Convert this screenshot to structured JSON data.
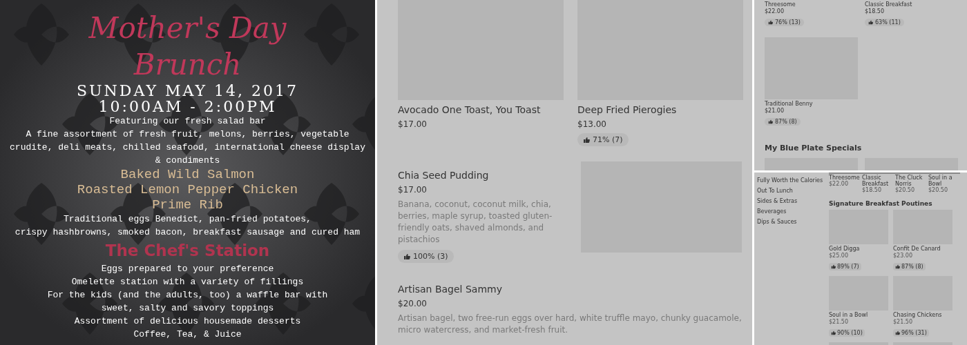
{
  "flyer": {
    "blocks": [
      {
        "kind": "script",
        "text": "Mother's Day"
      },
      {
        "kind": "script",
        "text": "Brunch"
      },
      {
        "kind": "caps",
        "text": "SUNDAY MAY 14, 2017"
      },
      {
        "kind": "caps",
        "text": "10:00AM - 2:00PM"
      },
      {
        "kind": "body",
        "text": "Featuring our fresh salad bar"
      },
      {
        "kind": "body",
        "text": "A fine assortment of fresh fruit, melons, berries, vegetable"
      },
      {
        "kind": "body",
        "text": "crudite, deli meats, chilled seafood, international cheese display"
      },
      {
        "kind": "body",
        "text": "& condiments"
      },
      {
        "kind": "entree",
        "text": "Baked Wild Salmon"
      },
      {
        "kind": "entree",
        "text": "Roasted Lemon Pepper Chicken"
      },
      {
        "kind": "entree",
        "text": "Prime Rib"
      },
      {
        "kind": "body",
        "text": "Traditional eggs Benedict, pan-fried potatoes,"
      },
      {
        "kind": "body",
        "text": "crispy hashbrowns, smoked bacon, breakfast sausage and cured ham"
      },
      {
        "kind": "station",
        "text": "The Chef's Station"
      },
      {
        "kind": "body",
        "text": "Eggs prepared to your preference"
      },
      {
        "kind": "body",
        "text": "Omelette station with a variety of fillings"
      },
      {
        "kind": "body",
        "text": "For the kids (and the adults, too) a waffle bar with"
      },
      {
        "kind": "body",
        "text": "sweet, salty and savory toppings"
      },
      {
        "kind": "body",
        "text": "Assortment of delicious housemade desserts"
      },
      {
        "kind": "body",
        "text": "Coffee, Tea, & Juice"
      }
    ]
  },
  "menu": {
    "items": [
      {
        "kind": "card",
        "name": "Avocado One Toast, You Toast",
        "price": "$17.00"
      },
      {
        "kind": "card",
        "name": "Deep Fried Pierogies",
        "price": "$13.00",
        "rating": "71% (7)"
      },
      {
        "kind": "row",
        "name": "Chia Seed Pudding",
        "price": "$17.00",
        "description": "Banana, coconut, coconut milk, chia, berries, maple syrup, toasted gluten-friendly oats, shaved almonds, and pistachios",
        "rating": "100% (3)"
      },
      {
        "kind": "text",
        "name": "Artisan Bagel Sammy",
        "price": "$20.00",
        "description": "Artisan bagel, two free-run eggs over hard, white truffle mayo, chunky guacamole, micro watercress, and market-fresh fruit."
      }
    ]
  },
  "small_menu": {
    "top_items": [
      {
        "name": "Threesome",
        "price": "$22.00",
        "rating": "76% (13)"
      },
      {
        "name": "Classic Breakfast",
        "price": "$18.50",
        "rating": "63% (11)"
      }
    ],
    "cards": [
      {
        "name": "Traditional Benny",
        "price": "$21.00",
        "rating": "87% (8)"
      }
    ],
    "heading": "My Blue Plate Specials"
  },
  "mini_menu": {
    "sidebar": [
      "Fully Worth the Calories",
      "Out To Lunch",
      "Sides & Extras",
      "Beverages",
      "Dips & Sauces"
    ],
    "strip": [
      {
        "name": "Threesome",
        "price": "$22.00"
      },
      {
        "name": "Classic Breakfast",
        "price": "$18.50"
      },
      {
        "name": "The Cluck Norris",
        "price": "$20.50"
      },
      {
        "name": "Soul in a Bowl",
        "price": "$20.50"
      }
    ],
    "heading": "Signature Breakfast Poutines",
    "cards": [
      {
        "name": "Gold Digga",
        "price": "$25.00",
        "rating": "89% (7)"
      },
      {
        "name": "Confit De Canard",
        "price": "$23.00",
        "rating": "87% (8)"
      },
      {
        "name": "Soul in a Bowl",
        "price": "$21.50",
        "rating": "90% (10)"
      },
      {
        "name": "Chasing Chickens",
        "price": "$21.50",
        "rating": "96% (31)"
      }
    ]
  }
}
